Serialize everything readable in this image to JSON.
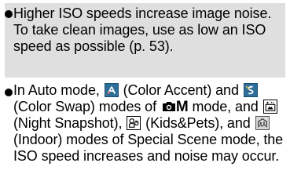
{
  "notes": [
    {
      "text": "Higher ISO speeds increase image noise. To take clean images, use as low an ISO speed as possible (p. 53)."
    },
    {
      "parts": {
        "p1": "In Auto mode, ",
        "p2": " (Color Accent) and ",
        "p3": " (Color Swap) modes of ",
        "mode_letter": "M",
        "p4": " mode, and ",
        "p5": " (Night Snapshot), ",
        "p6": " (Kids&Pets), and ",
        "p7": " (Indoor) modes of Special Scene mode, the ISO speed increases and noise may occur."
      },
      "icons": {
        "color_accent": "color-accent-icon",
        "color_swap": "color-swap-icon",
        "camera": "camera-icon",
        "night_snapshot": "night-snapshot-icon",
        "kids_pets": "kids-pets-icon",
        "indoor": "indoor-icon"
      }
    }
  ],
  "colors": {
    "shaded_background": "#dfdfdf",
    "icon_blue": "#2e6f9a",
    "text": "#000000"
  }
}
